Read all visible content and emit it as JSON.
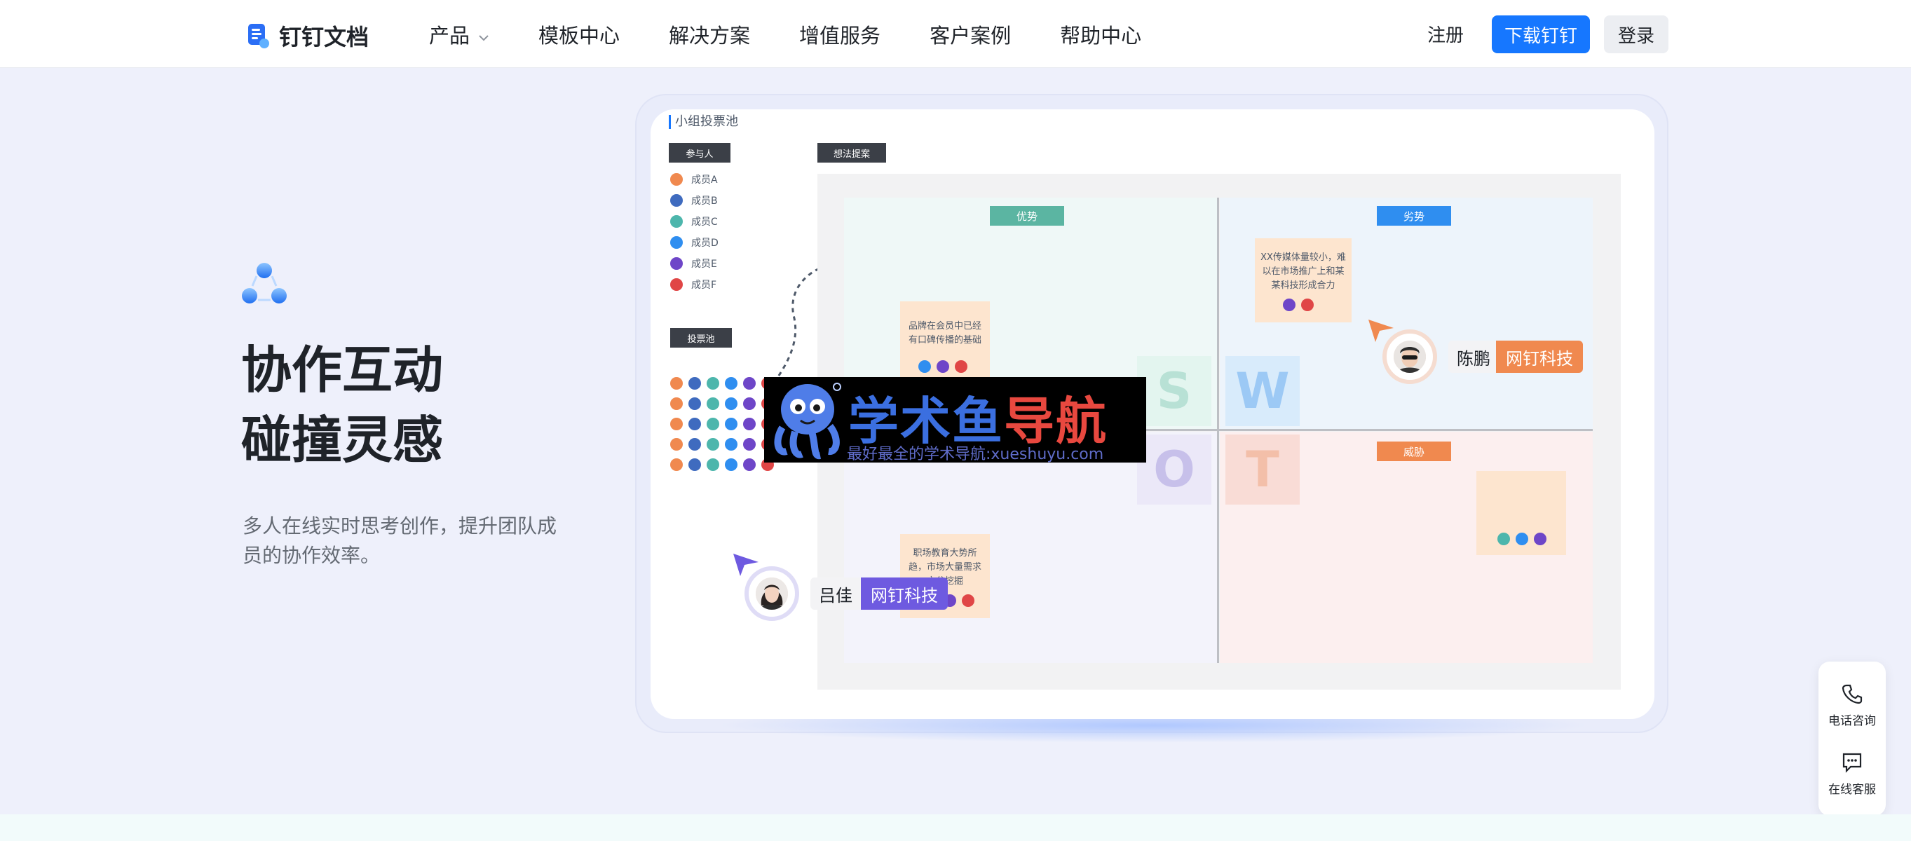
{
  "header": {
    "brand": "钉钉文档",
    "nav": [
      "产品",
      "模板中心",
      "解决方案",
      "增值服务",
      "客户案例",
      "帮助中心"
    ],
    "register_label": "注册",
    "download_label": "下载钉钉",
    "login_label": "登录"
  },
  "hero": {
    "title_line1": "协作互动",
    "title_line2": "碰撞灵感",
    "description": "多人在线实时思考创作，提升团队成员的协作效率。"
  },
  "board": {
    "pool_title": "小组投票池",
    "participants_label": "参与人",
    "ideas_label": "想法提案",
    "vote_pool_label": "投票池",
    "members": [
      {
        "name": "成员A",
        "color": "#f0894f"
      },
      {
        "name": "成员B",
        "color": "#3f6bbf"
      },
      {
        "name": "成员C",
        "color": "#4db6ac"
      },
      {
        "name": "成员D",
        "color": "#2f8ef0"
      },
      {
        "name": "成员E",
        "color": "#6e46c8"
      },
      {
        "name": "成员F",
        "color": "#e04646"
      }
    ],
    "quadrants": {
      "strength": "优势",
      "weakness": "劣势",
      "threat": "威胁"
    },
    "quadrant_colors": {
      "strength": "#5bb5a2",
      "weakness": "#2f8ef0",
      "threat": "#f0894f"
    },
    "swot_letters": [
      "S",
      "W",
      "O",
      "T"
    ],
    "notes": {
      "strength": "品牌在会员中已经有口碑传播的基础",
      "weakness": "XX传媒体量较小，难以在市场推广上和某某科技形成合力",
      "opportunity": "职场教育大势所趋，市场大量需求充分挖掘"
    }
  },
  "users": [
    {
      "name": "陈鹏",
      "company": "网钉科技",
      "color": "#f0894f"
    },
    {
      "name": "吕佳",
      "company": "网钉科技",
      "color": "#6e5ae0"
    }
  ],
  "watermark": {
    "part1": "学术鱼",
    "part2": "导航",
    "subtitle": "最好最全的学术导航:xueshuyu.com"
  },
  "service": {
    "phone_label": "电话咨询",
    "chat_label": "在线客服"
  }
}
